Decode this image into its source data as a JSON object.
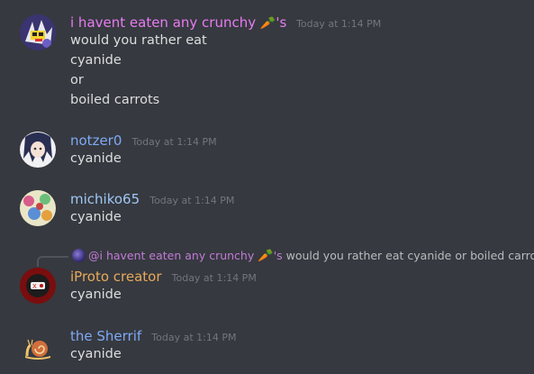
{
  "colors": {
    "background": "#36393f",
    "timestamp": "#72767d",
    "text": "#dcddde",
    "name_pink": "#e87bf2",
    "name_blue": "#7fa9f5",
    "name_lightblue": "#9fc6f5",
    "name_orange": "#e8a95a"
  },
  "messages": [
    {
      "author": "i havent eaten any crunchy",
      "author_suffix": "'s",
      "emoji": "🥕",
      "timestamp": "Today at 1:14 PM",
      "lines": [
        "would you rather eat",
        "cyanide",
        "or",
        "boiled carrots"
      ]
    },
    {
      "author": "notzer0",
      "timestamp": "Today at 1:14 PM",
      "lines": [
        "cyanide"
      ]
    },
    {
      "author": "michiko65",
      "timestamp": "Today at 1:14 PM",
      "lines": [
        "cyanide"
      ]
    },
    {
      "reply": {
        "mention": "@i havent eaten any crunchy",
        "emoji": "🥕",
        "suffix": "'s",
        "text": "would you rather eat cyanide or  boiled carrots"
      },
      "author": "iProto creator",
      "timestamp": "Today at 1:14 PM",
      "lines": [
        "cyanide"
      ]
    },
    {
      "author": "the Sherrif",
      "timestamp": "Today at 1:14 PM",
      "lines": [
        "cyanide"
      ]
    }
  ]
}
